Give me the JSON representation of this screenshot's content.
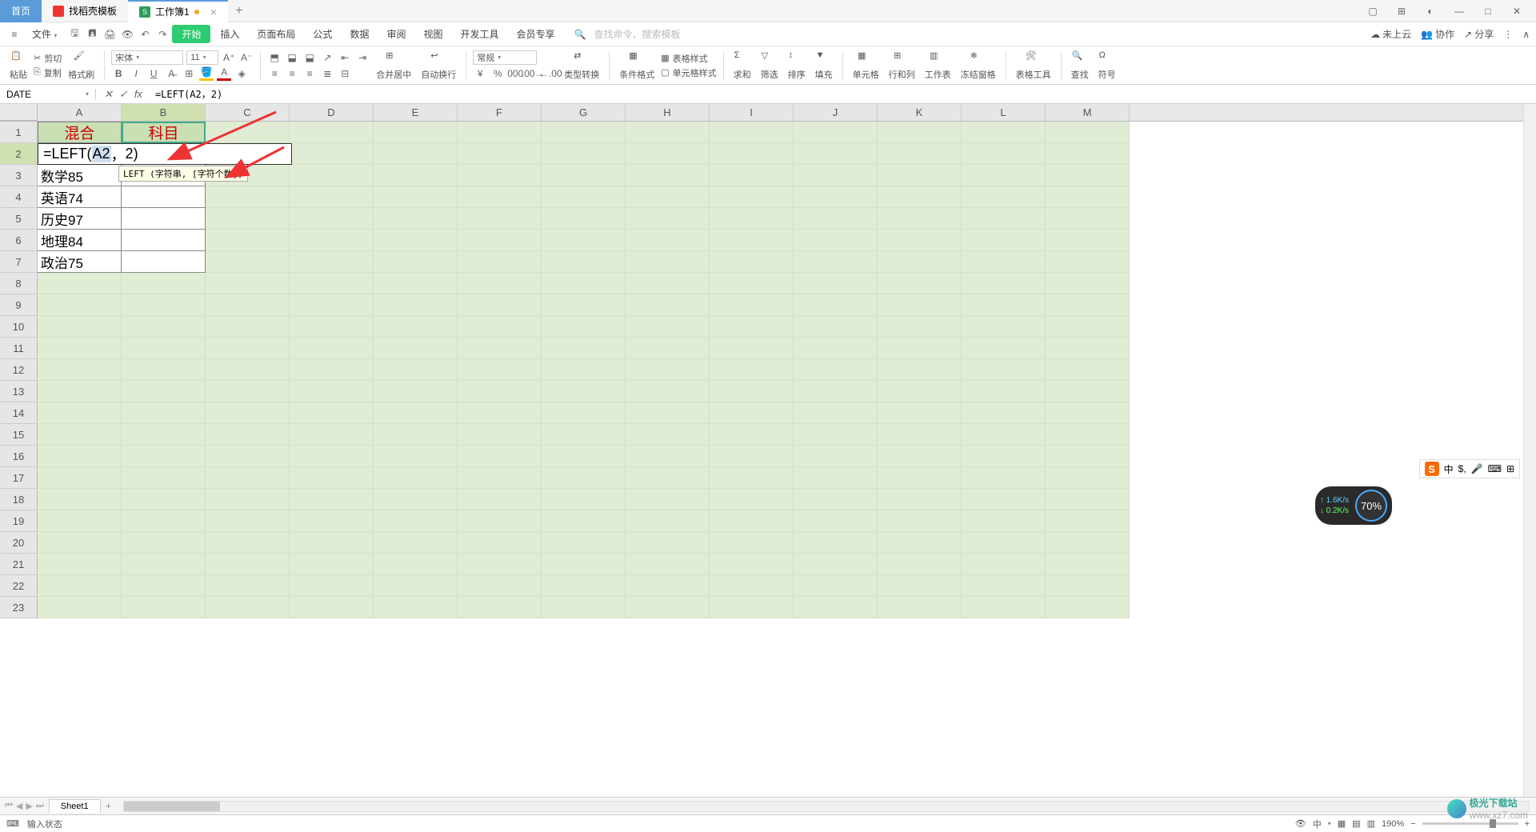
{
  "tabs": {
    "home": "首页",
    "template": "找稻壳模板",
    "doc": "工作簿1"
  },
  "menubar": {
    "file": "文件",
    "items": [
      "开始",
      "插入",
      "页面布局",
      "公式",
      "数据",
      "审阅",
      "视图",
      "开发工具",
      "会员专享"
    ],
    "search_cmd": "查找命令、搜索模板",
    "right": {
      "cloud": "未上云",
      "collab": "协作",
      "share": "分享"
    }
  },
  "toolbar": {
    "paste": "粘贴",
    "cut": "剪切",
    "copy": "复制",
    "format_painter": "格式刷",
    "font_name": "宋体",
    "font_size": "11",
    "merge": "合并居中",
    "wrap": "自动换行",
    "number_format": "常规",
    "type_convert": "类型转换",
    "cond_fmt": "条件格式",
    "table_style": "表格样式",
    "cell_style": "单元格样式",
    "sum": "求和",
    "filter": "筛选",
    "sort": "排序",
    "fill": "填充",
    "cells": "单元格",
    "rowcol": "行和列",
    "worksheet": "工作表",
    "freeze": "冻结窗格",
    "table_tools": "表格工具",
    "find": "查找",
    "symbol": "符号"
  },
  "formula_bar": {
    "name_box": "DATE",
    "formula": "=LEFT(A2，2)"
  },
  "grid": {
    "columns": [
      "A",
      "B",
      "C",
      "D",
      "E",
      "F",
      "G",
      "H",
      "I",
      "J",
      "K",
      "L",
      "M"
    ],
    "row_count": 23,
    "headers": {
      "A1": "混合",
      "B1": "科目"
    },
    "edit_display": {
      "prefix": "=LEFT(",
      "ref": "A2",
      "mid": "，",
      "arg": "2",
      "suffix": ")"
    },
    "tooltip": "LEFT (字符串, [字符个数])",
    "data": {
      "A3": "数学85",
      "A4": "英语74",
      "A5": "历史97",
      "A6": "地理84",
      "A7": "政治75"
    }
  },
  "sheet": {
    "name": "Sheet1"
  },
  "status": {
    "mode": "输入状态",
    "zoom": "190%"
  },
  "ime": {
    "lang": "中"
  },
  "perf": {
    "up": "1.6K/s",
    "down": "0.2K/s",
    "pct": "70%"
  },
  "watermark": {
    "text": "极光下载站",
    "url": "www.xz7.com"
  }
}
